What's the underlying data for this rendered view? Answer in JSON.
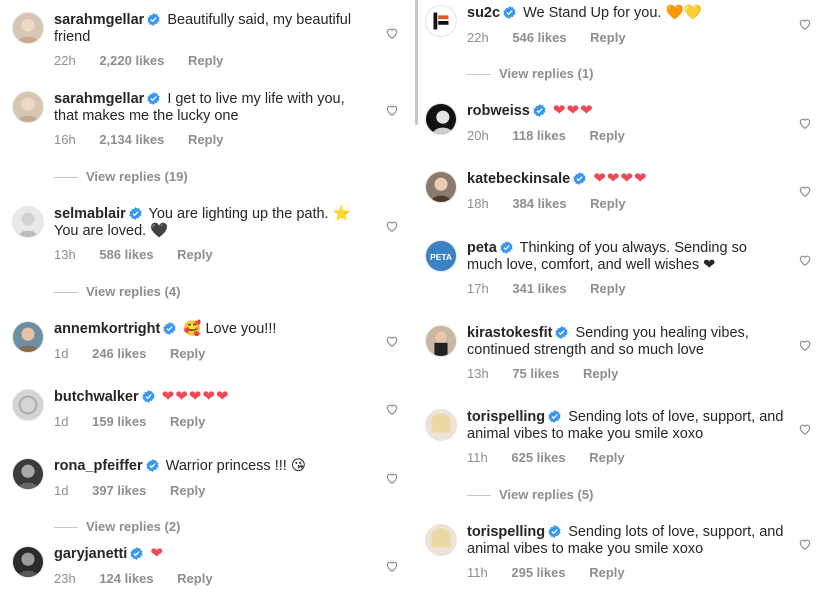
{
  "left": {
    "comments": [
      {
        "username": "sarahmgellar",
        "text": "Beautifully said, my beautiful friend",
        "time": "22h",
        "likes": "2,220 likes",
        "reply": "Reply"
      },
      {
        "username": "sarahmgellar",
        "text": "I get to live my life with you, that makes me the lucky one",
        "time": "16h",
        "likes": "2,134 likes",
        "reply": "Reply",
        "view_replies": "View replies (19)"
      },
      {
        "username": "selmablair",
        "text": "You are lighting up the path. ⭐ You are loved. 🖤",
        "time": "13h",
        "likes": "586 likes",
        "reply": "Reply",
        "view_replies": "View replies (4)"
      },
      {
        "username": "annemkortright",
        "text": "🥰 Love you!!!",
        "time": "1d",
        "likes": "246 likes",
        "reply": "Reply"
      },
      {
        "username": "butchwalker",
        "text": "❤❤❤❤❤",
        "time": "1d",
        "likes": "159 likes",
        "reply": "Reply"
      },
      {
        "username": "rona_pfeiffer",
        "text": "Warrior princess !!! 😘",
        "time": "1d",
        "likes": "397 likes",
        "reply": "Reply",
        "view_replies": "View replies (2)"
      },
      {
        "username": "garyjanetti",
        "text": "❤",
        "time": "23h",
        "likes": "124 likes",
        "reply": "Reply"
      }
    ]
  },
  "right": {
    "comments": [
      {
        "username": "su2c",
        "text": "We Stand Up for you. 🧡💛",
        "time": "22h",
        "likes": "546 likes",
        "reply": "Reply",
        "view_replies": "View replies (1)"
      },
      {
        "username": "robweiss",
        "text": "❤❤❤",
        "time": "20h",
        "likes": "118 likes",
        "reply": "Reply"
      },
      {
        "username": "katebeckinsale",
        "text": "❤❤❤❤",
        "time": "18h",
        "likes": "384 likes",
        "reply": "Reply"
      },
      {
        "username": "peta",
        "text": "Thinking of you always. Sending so much love, comfort, and well wishes ❤",
        "time": "17h",
        "likes": "341 likes",
        "reply": "Reply"
      },
      {
        "username": "kirastokesfit",
        "text": "Sending you healing vibes, continued strength and so much love",
        "time": "13h",
        "likes": "75 likes",
        "reply": "Reply"
      },
      {
        "username": "torispelling",
        "text": "Sending lots of love, support, and animal vibes to make you smile xoxo",
        "time": "11h",
        "likes": "625 likes",
        "reply": "Reply",
        "view_replies": "View replies (5)"
      },
      {
        "username": "torispelling",
        "text": "Sending lots of love, support, and animal vibes to make you smile xoxo",
        "time": "11h",
        "likes": "295 likes",
        "reply": "Reply"
      }
    ]
  },
  "icons": {
    "verified": "verified-badge-icon",
    "like": "heart-outline-icon"
  },
  "colors": {
    "verified": "#3897f0",
    "heart": "#ed4956",
    "meta": "#8e8e8e",
    "text": "#262626"
  }
}
